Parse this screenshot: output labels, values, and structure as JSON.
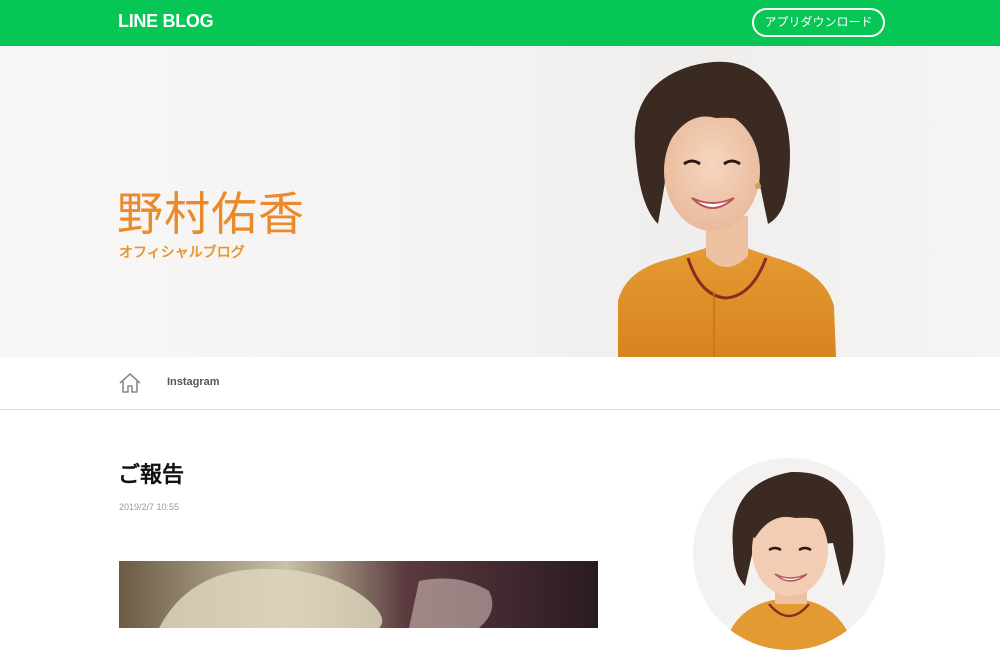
{
  "header": {
    "logo": "LINE BLOG",
    "app_download": "アプリダウンロード"
  },
  "hero": {
    "blog_name": "野村佑香",
    "blog_subtitle": "オフィシャルブログ"
  },
  "nav": {
    "home_icon": "home-icon",
    "links": [
      "Instagram"
    ]
  },
  "post": {
    "title": "ご報告",
    "date": "2019/2/7 10:55"
  },
  "colors": {
    "brand_green": "#06c755",
    "accent_orange": "#eb8a2c"
  }
}
